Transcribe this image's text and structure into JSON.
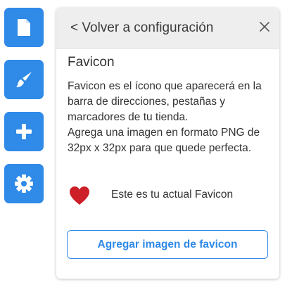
{
  "sidebar": {
    "items": [
      {
        "name": "pages",
        "icon": "document-icon"
      },
      {
        "name": "design",
        "icon": "paintbrush-icon"
      },
      {
        "name": "add",
        "icon": "plus-icon"
      },
      {
        "name": "settings",
        "icon": "gear-icon"
      }
    ],
    "accent": "#2f8ae8"
  },
  "panel": {
    "back_label": "< Volver a configuración",
    "close_icon": "close-icon",
    "title": "Favicon",
    "description_line1": "Favicon es el ícono que aparecerá en la barra de direcciones, pestañas y marcadores de tu tienda.",
    "description_line2": "Agrega una imagen en formato PNG de 32px x 32px para que quede perfecta.",
    "current_favicon_label": "Este es tu actual Favicon",
    "current_favicon_icon": "heart-icon",
    "heart_color": "#cc1f27",
    "add_button_label": "Agregar imagen de favicon"
  }
}
